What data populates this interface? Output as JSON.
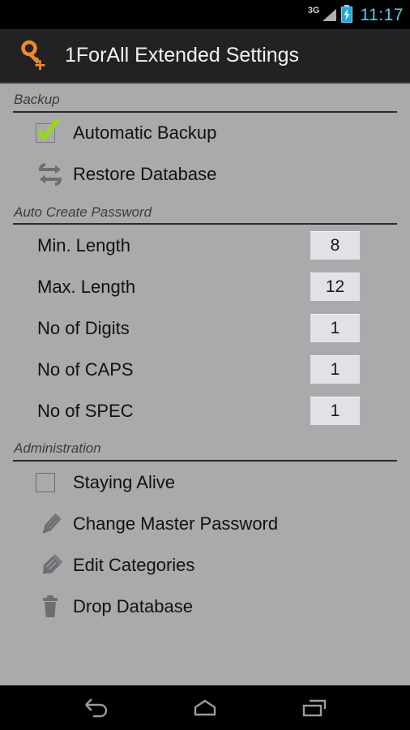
{
  "statusbar": {
    "network_label": "3G",
    "signal_icon": "signal-bars-icon",
    "battery_icon": "battery-charging-icon",
    "time": "11:17"
  },
  "actionbar": {
    "app_icon": "key-plus-icon",
    "title": "1ForAll Extended Settings"
  },
  "colors": {
    "background": "#aaaaad",
    "actionbar": "#222224",
    "accent_orange": "#f28a21",
    "check_green": "#9ad61e",
    "time_blue": "#5fc8e8",
    "value_box": "#e3e0e6"
  },
  "sections": [
    {
      "title": "Backup",
      "rows": [
        {
          "type": "checkbox",
          "label": "Automatic Backup",
          "checked": true,
          "icon": "checkbox-checked-icon"
        },
        {
          "type": "action",
          "label": "Restore Database",
          "icon": "restore-loop-icon"
        }
      ]
    },
    {
      "title": "Auto Create Password",
      "rows": [
        {
          "type": "number",
          "label": "Min. Length",
          "value": "8"
        },
        {
          "type": "number",
          "label": "Max. Length",
          "value": "12"
        },
        {
          "type": "number",
          "label": "No of Digits",
          "value": "1"
        },
        {
          "type": "number",
          "label": "No of CAPS",
          "value": "1"
        },
        {
          "type": "number",
          "label": "No of SPEC",
          "value": "1"
        }
      ]
    },
    {
      "title": "Administration",
      "rows": [
        {
          "type": "checkbox",
          "label": "Staying Alive",
          "checked": false,
          "icon": "checkbox-unchecked-icon"
        },
        {
          "type": "action",
          "label": "Change Master Password",
          "icon": "pencil-icon"
        },
        {
          "type": "action",
          "label": "Edit Categories",
          "icon": "pencil-eraser-icon"
        },
        {
          "type": "action",
          "label": "Drop Database",
          "icon": "trash-icon"
        }
      ]
    }
  ],
  "navbar": {
    "back": "back-icon",
    "home": "home-icon",
    "recents": "recents-icon"
  }
}
